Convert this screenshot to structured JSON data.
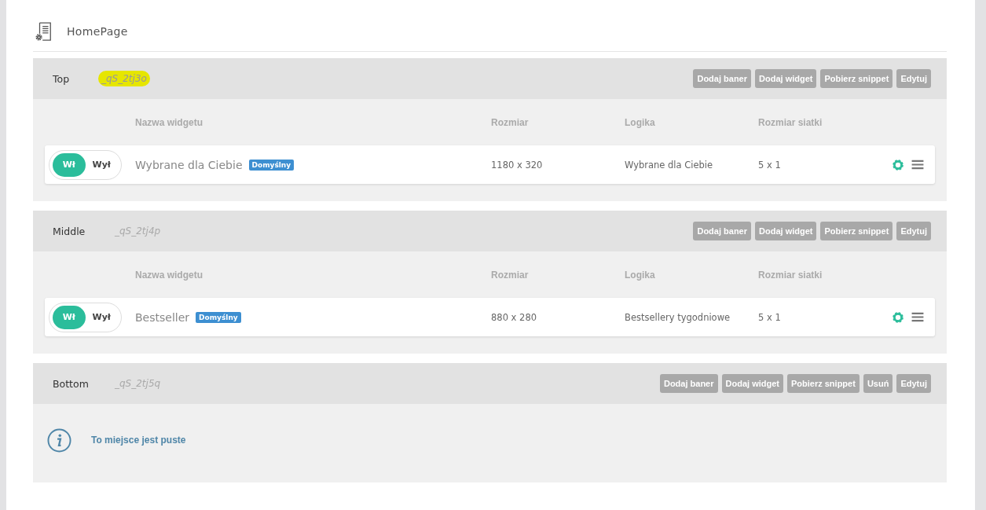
{
  "page": {
    "title": "HomePage"
  },
  "sections": [
    {
      "name": "Top",
      "code": "_qS_2tj3o",
      "highlighted": true,
      "buttons": [
        "Dodaj baner",
        "Dodaj widget",
        "Pobierz snippet",
        "Edytuj"
      ],
      "columns": [
        "Nazwa widgetu",
        "Rozmiar",
        "Logika",
        "Rozmiar siatki"
      ],
      "rows": [
        {
          "toggle_on": "Wł",
          "toggle_off": "Wył",
          "on": true,
          "name": "Wybrane dla Ciebie",
          "badge": "Domyślny",
          "size": "1180 x 320",
          "logic": "Wybrane dla Ciebie",
          "grid": "5 x 1"
        }
      ]
    },
    {
      "name": "Middle",
      "code": "_qS_2tj4p",
      "highlighted": false,
      "buttons": [
        "Dodaj baner",
        "Dodaj widget",
        "Pobierz snippet",
        "Edytuj"
      ],
      "columns": [
        "Nazwa widgetu",
        "Rozmiar",
        "Logika",
        "Rozmiar siatki"
      ],
      "rows": [
        {
          "toggle_on": "Wł",
          "toggle_off": "Wył",
          "on": true,
          "name": "Bestseller",
          "badge": "Domyślny",
          "size": "880 x 280",
          "logic": "Bestsellery tygodniowe",
          "grid": "5 x 1"
        }
      ]
    },
    {
      "name": "Bottom",
      "code": "_qS_2tj5q",
      "highlighted": false,
      "buttons": [
        "Dodaj baner",
        "Dodaj widget",
        "Pobierz snippet",
        "Usuń",
        "Edytuj"
      ],
      "empty_message": "To miejsce jest puste"
    }
  ]
}
